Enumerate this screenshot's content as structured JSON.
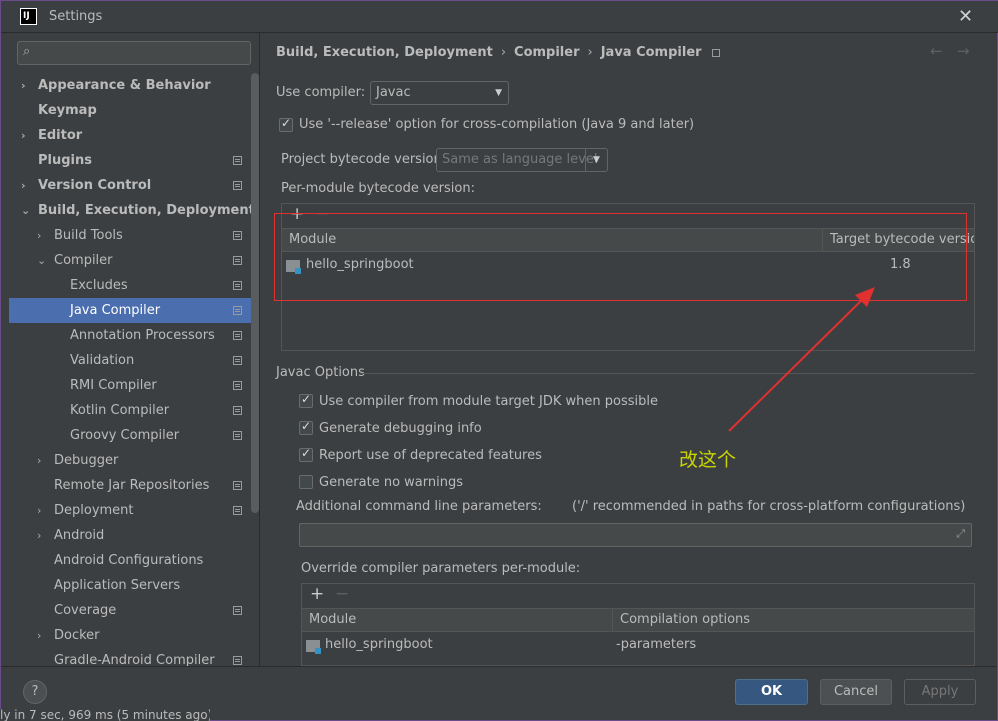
{
  "window": {
    "title": "Settings"
  },
  "sidebar": {
    "search_placeholder": "",
    "items": [
      {
        "label": "Appearance & Behavior",
        "level": 0,
        "arrow": "›",
        "bold": true,
        "icon": false
      },
      {
        "label": "Keymap",
        "level": 0,
        "arrow": "",
        "bold": true,
        "icon": false
      },
      {
        "label": "Editor",
        "level": 0,
        "arrow": "›",
        "bold": true,
        "icon": false
      },
      {
        "label": "Plugins",
        "level": 0,
        "arrow": "",
        "bold": true,
        "icon": true
      },
      {
        "label": "Version Control",
        "level": 0,
        "arrow": "›",
        "bold": true,
        "icon": true
      },
      {
        "label": "Build, Execution, Deployment",
        "level": 0,
        "arrow": "⌄",
        "bold": true,
        "icon": false
      },
      {
        "label": "Build Tools",
        "level": 1,
        "arrow": "›",
        "bold": false,
        "icon": true
      },
      {
        "label": "Compiler",
        "level": 1,
        "arrow": "⌄",
        "bold": false,
        "icon": true
      },
      {
        "label": "Excludes",
        "level": 2,
        "arrow": "",
        "bold": false,
        "icon": true
      },
      {
        "label": "Java Compiler",
        "level": 2,
        "arrow": "",
        "bold": false,
        "icon": true,
        "selected": true
      },
      {
        "label": "Annotation Processors",
        "level": 2,
        "arrow": "",
        "bold": false,
        "icon": true
      },
      {
        "label": "Validation",
        "level": 2,
        "arrow": "",
        "bold": false,
        "icon": true
      },
      {
        "label": "RMI Compiler",
        "level": 2,
        "arrow": "",
        "bold": false,
        "icon": true
      },
      {
        "label": "Kotlin Compiler",
        "level": 2,
        "arrow": "",
        "bold": false,
        "icon": true
      },
      {
        "label": "Groovy Compiler",
        "level": 2,
        "arrow": "",
        "bold": false,
        "icon": true
      },
      {
        "label": "Debugger",
        "level": 1,
        "arrow": "›",
        "bold": false,
        "icon": false
      },
      {
        "label": "Remote Jar Repositories",
        "level": 1,
        "arrow": "",
        "bold": false,
        "icon": true
      },
      {
        "label": "Deployment",
        "level": 1,
        "arrow": "›",
        "bold": false,
        "icon": true
      },
      {
        "label": "Android",
        "level": 1,
        "arrow": "›",
        "bold": false,
        "icon": false
      },
      {
        "label": "Android Configurations",
        "level": 1,
        "arrow": "",
        "bold": false,
        "icon": false
      },
      {
        "label": "Application Servers",
        "level": 1,
        "arrow": "",
        "bold": false,
        "icon": false
      },
      {
        "label": "Coverage",
        "level": 1,
        "arrow": "",
        "bold": false,
        "icon": true
      },
      {
        "label": "Docker",
        "level": 1,
        "arrow": "›",
        "bold": false,
        "icon": false
      },
      {
        "label": "Gradle-Android Compiler",
        "level": 1,
        "arrow": "",
        "bold": false,
        "icon": true
      }
    ]
  },
  "breadcrumb": {
    "part1": "Build, Execution, Deployment",
    "part2": "Compiler",
    "part3": "Java Compiler",
    "sep": "›"
  },
  "nav": {
    "back": "←",
    "forward": "→"
  },
  "compiler": {
    "use_compiler_label": "Use compiler:",
    "use_compiler_value": "Javac",
    "release_option_label": "Use '--release' option for cross-compilation (Java 9 and later)",
    "project_bytecode_label": "Project bytecode version:",
    "project_bytecode_value": "Same as language level",
    "per_module_label": "Per-module bytecode version:"
  },
  "module_table": {
    "plus": "+",
    "minus": "−",
    "col_module": "Module",
    "col_target": "Target bytecode version",
    "rows": [
      {
        "module": "hello_springboot",
        "target": "1.8"
      }
    ]
  },
  "javac": {
    "section_title": "Javac Options",
    "opt1": "Use compiler from module target JDK when possible",
    "opt2": "Generate debugging info",
    "opt3": "Report use of deprecated features",
    "opt4": "Generate no warnings",
    "additional_label": "Additional command line parameters:",
    "additional_hint": "('/' recommended in paths for cross-platform configurations)",
    "override_label": "Override compiler parameters per-module:"
  },
  "override_table": {
    "plus": "+",
    "minus": "−",
    "col_module": "Module",
    "col_options": "Compilation options",
    "rows": [
      {
        "module": "hello_springboot",
        "options": "-parameters"
      }
    ]
  },
  "annotation": {
    "text": "改这个",
    "color": "#c8d400",
    "box_color": "#e03030"
  },
  "buttons": {
    "help": "?",
    "ok": "OK",
    "cancel": "Cancel",
    "apply": "Apply"
  },
  "status": {
    "text": "ly in 7 sec, 969 ms (5 minutes ago)"
  },
  "colors": {
    "selection": "#4b6eaf",
    "primary_button": "#365880",
    "background": "#3c3f41"
  }
}
